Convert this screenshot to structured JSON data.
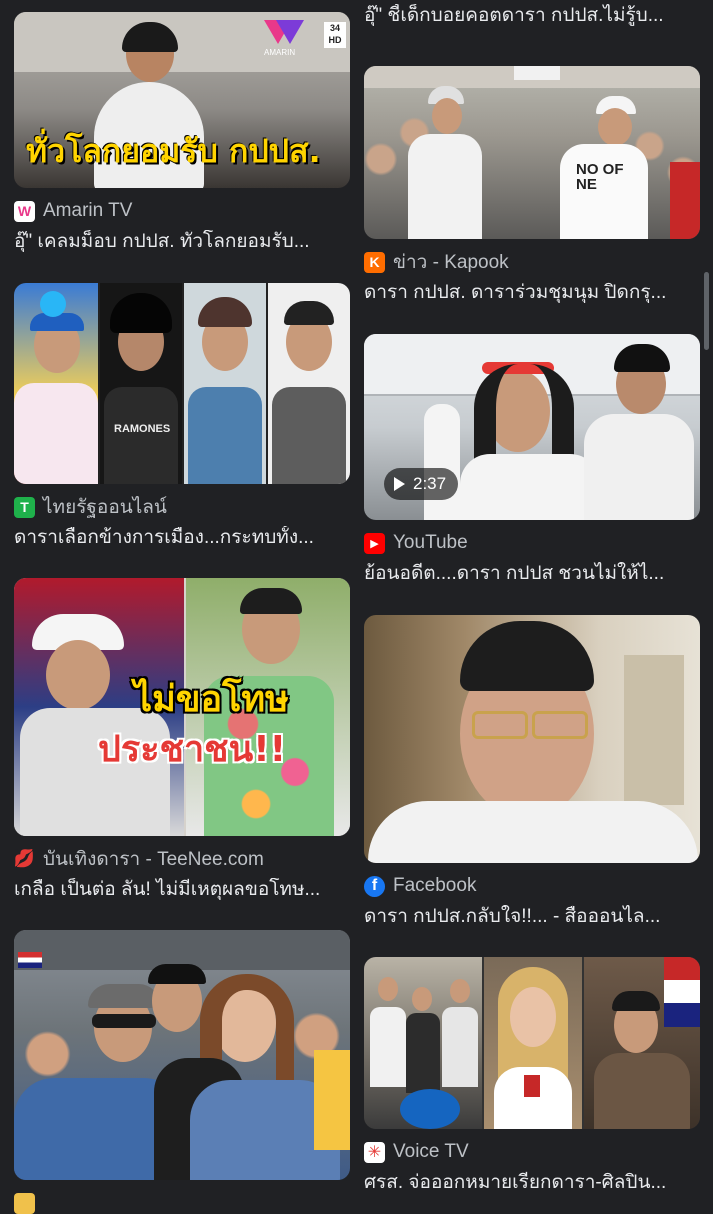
{
  "left_column": [
    {
      "overlay_text": "ทั่วโลกยอมรับ กปปส.",
      "watermark": "AMARIN",
      "channel_badge": "34 HD",
      "source": "Amarin TV",
      "favicon": {
        "letter": "W",
        "color": "#e9388a"
      },
      "title": "อุ๊\" เคลมม็อบ กปปส. ทั่วโลกยอมรับ..."
    },
    {
      "overlay_text": "",
      "shirt_text": "RAMONES",
      "source": "ไทยรัฐออนไลน์",
      "favicon": {
        "letter": "T",
        "color": "#1fb14b"
      },
      "title": "ดาราเลือกข้างการเมือง...กระทบทั้ง..."
    },
    {
      "overlay_text_1": "ไม่ขอโทษ",
      "overlay_text_2": "ประชาชน!!",
      "source": "บันเทิงดารา - TeeNee.com",
      "favicon": {
        "letter": "💋",
        "color": "#202124"
      },
      "title": "เกลือ เป็นต่อ ลั่น! ไม่มีเหตุผลขอโทษ..."
    },
    {
      "overlay_text": "",
      "source": "",
      "favicon": {
        "letter": "",
        "color": "#f0c14b"
      },
      "title": ""
    }
  ],
  "right_column": [
    {
      "source": "",
      "favicon": {
        "letter": "",
        "color": "#e53935"
      },
      "title": "อุ๊\" ชี้เด็กบอยคอตดารา กปปส.ไม่รู้บ..."
    },
    {
      "shirt_text": "NO OF NE",
      "source": "ข่าว - Kapook",
      "favicon": {
        "letter": "K",
        "color": "#ff6d00"
      },
      "title": "ดารา กปปส. ดาราร่วมชุมนุม ปิดกรุ..."
    },
    {
      "duration": "2:37",
      "source": "YouTube",
      "favicon": {
        "letter": "▶",
        "color": "#ff0000"
      },
      "title": "ย้อนอดีต....ดารา กปปส ชวนไม่ให้ไ..."
    },
    {
      "source": "Facebook",
      "favicon": {
        "letter": "f",
        "color": "#1877f2"
      },
      "title": "ดารา กปปส.กลับใจ!!... - สื่อออนไล..."
    },
    {
      "source": "Voice TV",
      "favicon": {
        "letter": "✳",
        "color": "#ffffff"
      },
      "title": "ศรส. จ่อออกหมายเรียกดารา-ศิลปิน..."
    }
  ]
}
